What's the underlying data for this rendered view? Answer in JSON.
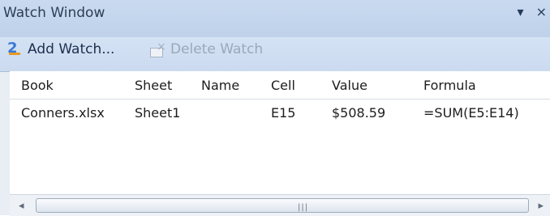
{
  "window": {
    "title": "Watch Window",
    "dropdown_glyph": "▾",
    "close_glyph": "×"
  },
  "toolbar": {
    "add_label": "Add Watch...",
    "add_icon": "add-watch-icon",
    "delete_label": "Delete Watch",
    "delete_icon": "delete-watch-icon"
  },
  "table": {
    "columns": [
      "Book",
      "Sheet",
      "Name",
      "Cell",
      "Value",
      "Formula"
    ],
    "rows": [
      [
        "Conners.xlsx",
        "Sheet1",
        "",
        "E15",
        "$508.59",
        "=SUM(E5:E14)"
      ]
    ]
  },
  "scrollbar": {
    "left_arrow": "◂",
    "right_arrow": "▸",
    "grip": "|||"
  },
  "colors": {
    "title_bar": "#c9daf0",
    "toolbar": "#d4e2f4",
    "grid_background": "#ffffff"
  }
}
